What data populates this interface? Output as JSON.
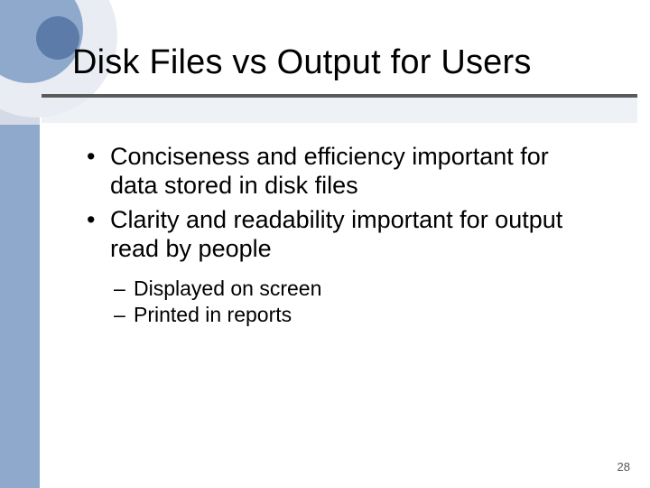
{
  "title": "Disk Files vs Output for Users",
  "bullets": [
    {
      "text": "Conciseness and efficiency important for data stored in disk files"
    },
    {
      "text": "Clarity and readability important for output read by people"
    }
  ],
  "sub_bullets": [
    {
      "text": "Displayed on screen"
    },
    {
      "text": "Printed in reports"
    }
  ],
  "page_number": "28",
  "marks": {
    "dot": "•",
    "dash": "–"
  }
}
